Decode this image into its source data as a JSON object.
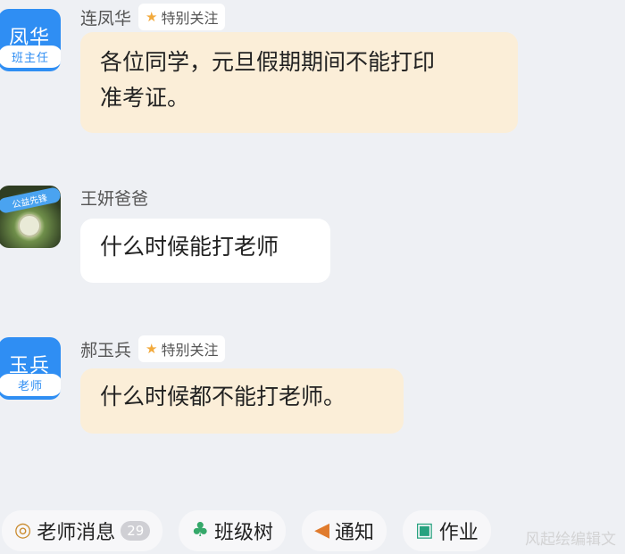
{
  "messages": [
    {
      "avatar_text": "凤华",
      "avatar_role": "班主任",
      "sender": "连凤华",
      "badge": "特别关注",
      "lines": [
        "各位同学，元旦假期期间不能打印",
        "准考证。"
      ]
    },
    {
      "avatar_caption": "公益先锋",
      "sender": "王妍爸爸",
      "lines": [
        "什么时候能打老师"
      ]
    },
    {
      "avatar_text": "玉兵",
      "avatar_role": "老师",
      "sender": "郝玉兵",
      "badge": "特别关注",
      "lines": [
        "什么时候都不能打老师。"
      ]
    }
  ],
  "bottom_bar": {
    "teacher_messages": "老师消息",
    "teacher_messages_count": "29",
    "class_tree": "班级树",
    "notice": "通知",
    "homework": "作业"
  },
  "watermark": "风起绘编辑文"
}
